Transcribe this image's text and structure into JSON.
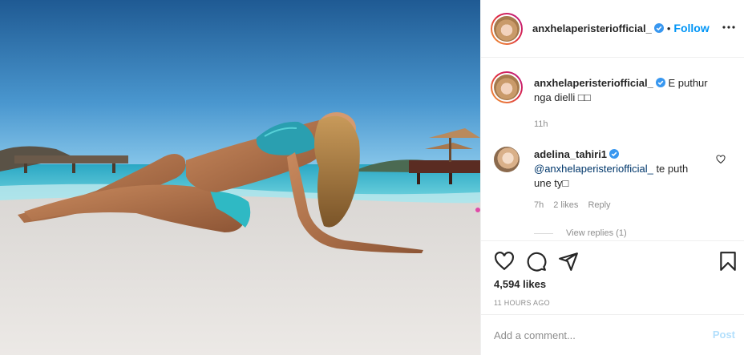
{
  "post": {
    "image_alt": "Woman in a turquoise bikini reclining on a white sand beach",
    "colors": {
      "sky_top": "#2d6aa3",
      "sky_bottom": "#6fb6e0",
      "sea": "#45c6d6",
      "sand": "#e9e6e2",
      "bikini": "#2fb9c4"
    }
  },
  "header": {
    "username": "anxhelaperisteriofficial_",
    "verified_icon": "verified-badge-icon",
    "separator": "•",
    "follow_label": "Follow",
    "more_icon": "more-options-icon"
  },
  "caption": {
    "username": "anxhelaperisteriofficial_",
    "text_line1": "E puthur",
    "text_line2": "nga dielli □□",
    "time": "11h"
  },
  "comment": {
    "username": "adelina_tahiri1",
    "mention": "@anxhelaperisteriofficial_",
    "text_after_mention": " te puth",
    "text_line2": "une ty□",
    "time": "7h",
    "likes": "2 likes",
    "reply_label": "Reply",
    "view_replies": "View replies (1)"
  },
  "actions": {
    "like_icon": "heart-icon",
    "comment_icon": "comment-icon",
    "share_icon": "share-icon",
    "save_icon": "bookmark-icon",
    "likes_count": "4,594 likes",
    "posted_ago": "11 HOURS AGO"
  },
  "add_comment": {
    "placeholder": "Add a comment...",
    "post_label": "Post"
  }
}
